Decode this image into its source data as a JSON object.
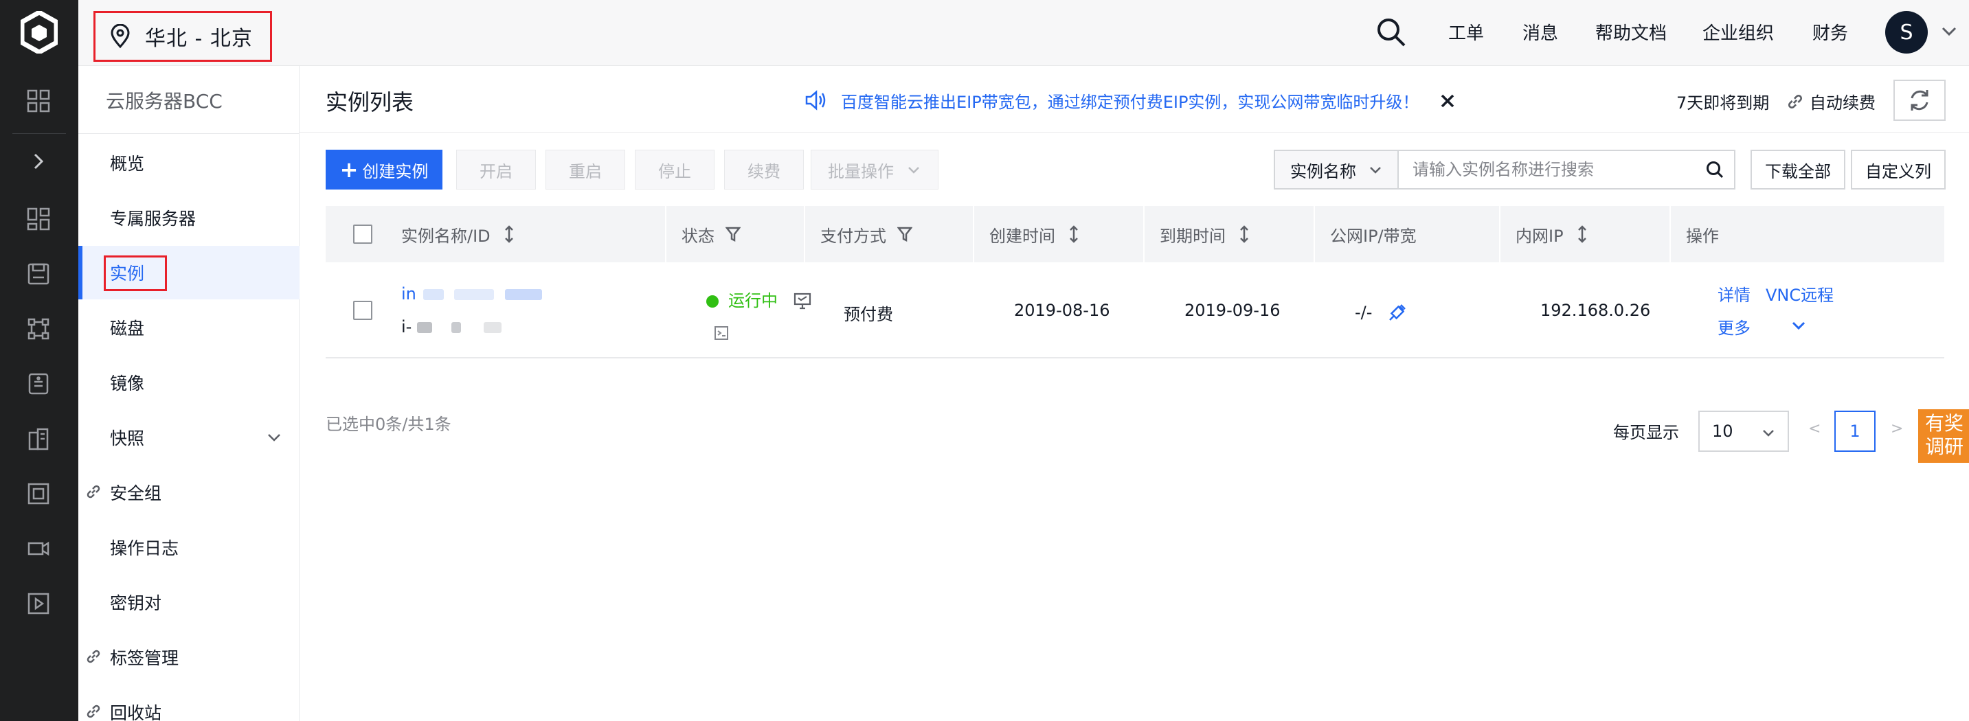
{
  "header": {
    "region": "华北 - 北京",
    "nav": [
      "工单",
      "消息",
      "帮助文档",
      "企业组织",
      "财务"
    ],
    "avatar_letter": "S"
  },
  "sidebar": {
    "title": "云服务器BCC",
    "items": [
      {
        "label": "概览"
      },
      {
        "label": "专属服务器"
      },
      {
        "label": "实例"
      },
      {
        "label": "磁盘"
      },
      {
        "label": "镜像"
      },
      {
        "label": "快照"
      },
      {
        "label": "安全组"
      },
      {
        "label": "操作日志"
      },
      {
        "label": "密钥对"
      },
      {
        "label": "标签管理"
      },
      {
        "label": "回收站"
      }
    ]
  },
  "main": {
    "title": "实例列表",
    "notice": "百度智能云推出EIP带宽包，通过绑定预付费EIP实例，实现公网带宽临时升级！",
    "expire": "7天即将到期",
    "auto_renew": "自动续费",
    "toolbar": {
      "create": "创建实例",
      "start": "开启",
      "restart": "重启",
      "stop": "停止",
      "renew": "续费",
      "batch": "批量操作",
      "search_select": "实例名称",
      "search_placeholder": "请输入实例名称进行搜索",
      "download_all": "下载全部",
      "custom_columns": "自定义列"
    },
    "table": {
      "columns": [
        "实例名称/ID",
        "状态",
        "支付方式",
        "创建时间",
        "到期时间",
        "公网IP/带宽",
        "内网IP",
        "操作"
      ],
      "rows": [
        {
          "name": "in",
          "id": "i-",
          "status": "运行中",
          "payment": "预付费",
          "created": "2019-08-16",
          "expires": "2019-09-16",
          "public_ip": "-/-",
          "private_ip": "192.168.0.26",
          "actions": [
            "详情",
            "VNC远程",
            "更多"
          ]
        }
      ]
    },
    "footer": {
      "selected": "已选中0条/共1条",
      "per_page_label": "每页显示",
      "per_page": "10",
      "prev": "<",
      "next": ">",
      "page": "1"
    },
    "survey": "有奖调研"
  },
  "colors": {
    "accent": "#2468f2",
    "rail": "#1f2021",
    "status_running": "#30bf13",
    "highlight_box": "#e8202a",
    "survey": "#f08a24"
  }
}
